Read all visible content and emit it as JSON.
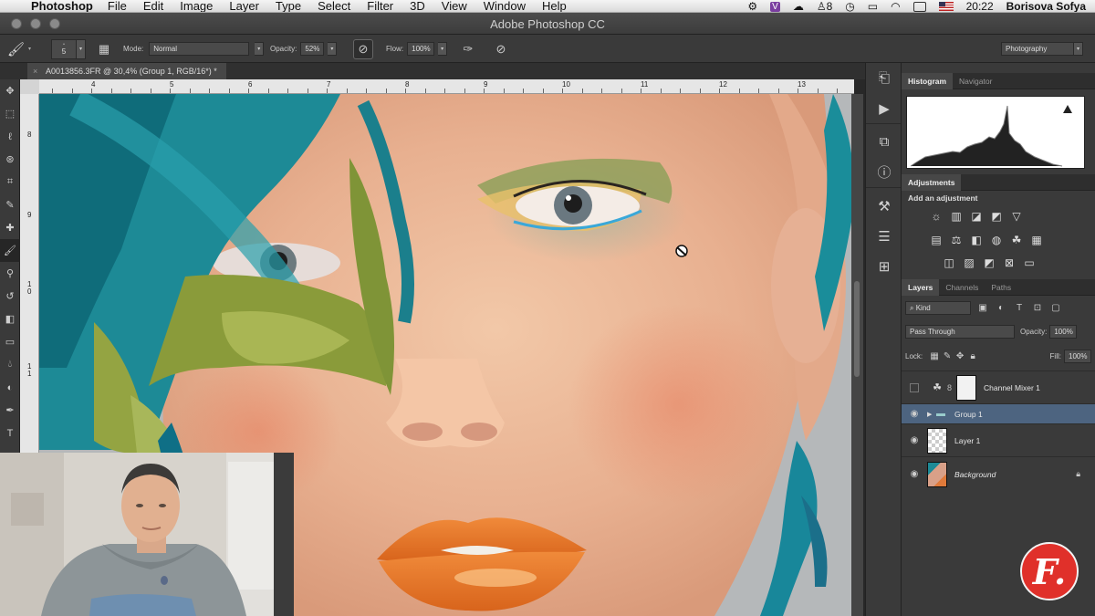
{
  "menubar": {
    "app_name": "Photoshop",
    "items": [
      "File",
      "Edit",
      "Image",
      "Layer",
      "Type",
      "Select",
      "Filter",
      "3D",
      "View",
      "Window",
      "Help"
    ],
    "badge_count": "8",
    "clock": "20:22",
    "user": "Borisova Sofya"
  },
  "window": {
    "title": "Adobe Photoshop CC"
  },
  "options": {
    "brush_size": "5",
    "mode_label": "Mode:",
    "mode_value": "Normal",
    "opacity_label": "Opacity:",
    "opacity_value": "52%",
    "flow_label": "Flow:",
    "flow_value": "100%",
    "workspace": "Photography"
  },
  "document": {
    "tab_title": "A0013856.3FR @ 30,4% (Group 1, RGB/16*) *"
  },
  "rulers": {
    "h_labels": [
      "4",
      "5",
      "6",
      "7",
      "8",
      "9",
      "10",
      "11",
      "12",
      "13"
    ],
    "v_labels": [
      "8",
      "9",
      "1\n0",
      "1\n1"
    ]
  },
  "panels": {
    "top_tabs": [
      "Histogram",
      "Navigator"
    ],
    "adjustments_tab": "Adjustments",
    "adjustments_title": "Add an adjustment",
    "layers_tabs": [
      "Layers",
      "Channels",
      "Paths"
    ],
    "filter_kind": "Kind",
    "blend_mode": "Pass Through",
    "opacity_label": "Opacity:",
    "opacity_value": "100%",
    "lock_label": "Lock:",
    "fill_label": "Fill:",
    "fill_value": "100%"
  },
  "layers": [
    {
      "name": "Channel Mixer 1",
      "visible": false,
      "selected": false
    },
    {
      "name": "Group 1",
      "visible": true,
      "selected": true
    },
    {
      "name": "Layer 1",
      "visible": true,
      "selected": false
    },
    {
      "name": "Background",
      "visible": true,
      "selected": false,
      "locked": true
    }
  ],
  "colors": {
    "selection": "#4d6480",
    "panel": "#3a3a3a",
    "logo": "#e0302a"
  },
  "logo_letter": "F."
}
